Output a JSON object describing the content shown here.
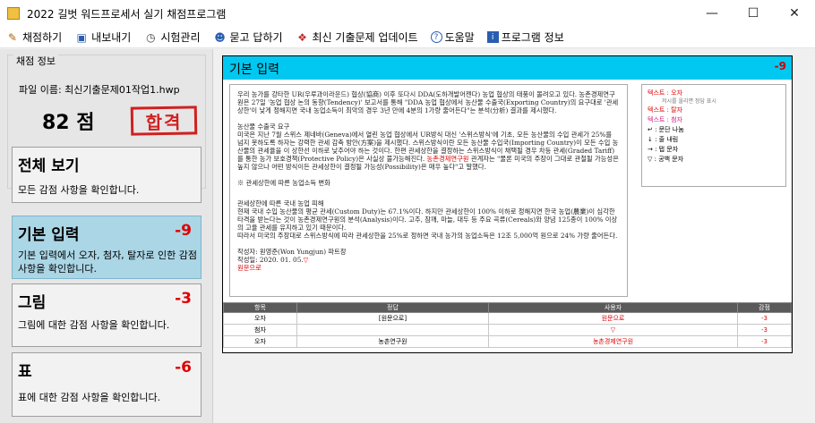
{
  "window": {
    "title": "2022 길벗 워드프로세서 실기 채점프로그램"
  },
  "menu": [
    {
      "label": "채점하기",
      "icon": "pencil-icon",
      "glyph": "✎"
    },
    {
      "label": "내보내기",
      "icon": "save-icon",
      "glyph": "▣"
    },
    {
      "label": "시험관리",
      "icon": "timer-icon",
      "glyph": "◷"
    },
    {
      "label": "묻고 답하기",
      "icon": "people-icon",
      "glyph": "☻"
    },
    {
      "label": "최신 기출문제 업데이트",
      "icon": "gift-icon",
      "glyph": "❖"
    },
    {
      "label": "도움말",
      "icon": "help-icon",
      "glyph": "?"
    },
    {
      "label": "프로그램 정보",
      "icon": "info-icon",
      "glyph": "i"
    }
  ],
  "score_info": {
    "legend": "채점 정보",
    "file_label": "파일 이름: 최신기출문제01작업1.hwp",
    "score": "82 점",
    "stamp": "합격"
  },
  "cards": [
    {
      "title": "전체 보기",
      "penalty": "",
      "desc": "모든 감점 사항을 확인합니다."
    },
    {
      "title": "기본 입력",
      "penalty": "-9",
      "desc": "기본 입력에서 오자, 첨자, 탈자로 인한 감점 사항을 확인합니다."
    },
    {
      "title": "그림",
      "penalty": "-3",
      "desc": "그림에 대한 감점 사항을 확인합니다."
    },
    {
      "title": "표",
      "penalty": "-6",
      "desc": "표에 대한 감점 사항을 확인합니다."
    }
  ],
  "panel": {
    "title": "기본 입력",
    "penalty": "-9",
    "doc": {
      "p1": "우리 농가를 강타한 UR(우루과이라운드) 협상(協商) 이후 또다시 DDA(도하개발어젠다) 농업 협상의 태풍이 몰려오고 있다. 농촌경제연구원은 27일 '농업 협상 논의 동향(Tendency)' 보고서를 통해 \"DDA 농업 협상에서 농산물 수출국(Exporting Country)의 요구대로 '관세상한'이 낮게 정해지면 국내 농업소득이 최악의 경우 3년 만에 4분의 1가량 줄어든다\"는 분석(分析) 결과를 제시했다.",
      "p2a": "농산물 수출국 요구",
      "p2b": "미국은 지난 7월 스위스 제네바(Geneva)에서 열린 농업 협상에서 UR방식 대신 '스위스방식'에 기초, 모든 농산물의 수입 관세가 25%를 넘지 못하도록 하자는 강력한 관세 감축 방안(方案)을 제시했다. 스위스방식이란 모든 농산물 수입국(Importing Country)이 모든 수입 농산물의 관세율을 이 상한선 이하로 낮추어야 하는 것이다. 한편 관세상한을 결정하는 스위스방식이 채택될 경우 차등 관세(Graded Tariff)를 통한 농가 보호경책(Protective Policy)은 사실상 불가능해진다.",
      "p2red": "농촌경제연구원",
      "p2c": "관계자는 \"물론 미국의 주장이 그대로 관철될 가능성은 높지 않으나 어떤 방식이든 관세상한이 결정될 가능성(Possibility)은 매우 높다\"고 말했다.",
      "p3": "※ 관세상한에 따른 농업소득 변화",
      "p4a": "관세상한에 따른 국내 농업 피해",
      "p4b": "현재 국내 수입 농산물의 평균 관세(Custom Duty)는 67.1%이다. 하지만 관세상한이 100% 이하로 정해지면 한국 농업(農業)이 심각한 타격을 받는다는 것이 농촌경제연구원의 분석(Analysis)이다. 고추, 참깨, 마늘, 대두 등 주요 곡류(Cereals)와 양념 125종이 100% 이상의 고율 관세를 유지하고 있기 때문이다.",
      "p4c": "따라서 미국의 주장대로 스위스방식에 따라 관세상한을 25%로 정하면 국내 농가의 농업소득은 12조 5,000억 원으로 24% 가량 줄어든다.",
      "p5a": "작성자: 원영준(Won Yungjun) 파트장",
      "p5b": "작성일: 2020. 01. 05.",
      "p5mark": "▽",
      "p5red": "원문으로"
    },
    "legend_items": [
      {
        "label": "텍스트 : 오자",
        "sub": "저시를 올리면 정답 표시"
      },
      {
        "label": "텍스트 : 탈자"
      },
      {
        "label": "텍스트 : 첨자"
      },
      {
        "label": "↵ : 문단 나눔"
      },
      {
        "label": "↓ : 줄 내림"
      },
      {
        "label": "→ : 탭 문자"
      },
      {
        "label": "▽ : 공백 문자"
      }
    ],
    "table": {
      "headers": [
        "항목",
        "정답",
        "사용자",
        "감점"
      ],
      "rows": [
        [
          "오자",
          "[원문으로]",
          "원문으로",
          "-3"
        ],
        [
          "첨자",
          "",
          "▽",
          "-3"
        ],
        [
          "오자",
          "농촌연구원",
          "농촌경제연구원",
          "-3"
        ]
      ]
    }
  },
  "colors": {
    "accent": "#00c8f0",
    "penalty": "#e00000",
    "active_card": "#abd6e6"
  }
}
